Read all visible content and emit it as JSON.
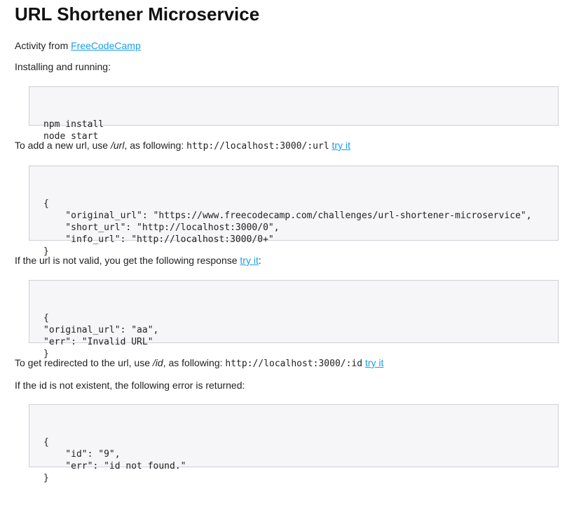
{
  "title": "URL Shortener Microservice",
  "intro": {
    "text": "Activity from ",
    "link": "FreeCodeCamp"
  },
  "install_heading": "Installing and running:",
  "install_code": [
    "npm install",
    "node start"
  ],
  "add_url": {
    "text_before": "To add a new url, use ",
    "path": "/url",
    "text_mid": ", as following: ",
    "code": "http://localhost:3000/:url",
    "link": "try it"
  },
  "add_url_code": [
    "{",
    "    \"original_url\": \"https://www.freecodecamp.com/challenges/url-shortener-microservice\",",
    "    \"short_url\": \"http://localhost:3000/0\",",
    "    \"info_url\": \"http://localhost:3000/0+\"",
    "}"
  ],
  "invalid_url": {
    "text": "If the url is not valid, you get the following response ",
    "link": "try it",
    "suffix": ":"
  },
  "invalid_url_code": [
    "{",
    "\"original_url\": \"aa\",",
    "\"err\": \"Invalid URL\"",
    "}"
  ],
  "redirect": {
    "text_before": "To get redirected to the url, use ",
    "path": "/id",
    "text_mid": ", as following: ",
    "code": "http://localhost:3000/:id",
    "link": "try it"
  },
  "not_found_heading": "If the id is not existent, the following error is returned:",
  "not_found_code": [
    "{",
    "    \"id\": \"9\",",
    "    \"err\": \"id not found.\"",
    "}"
  ]
}
